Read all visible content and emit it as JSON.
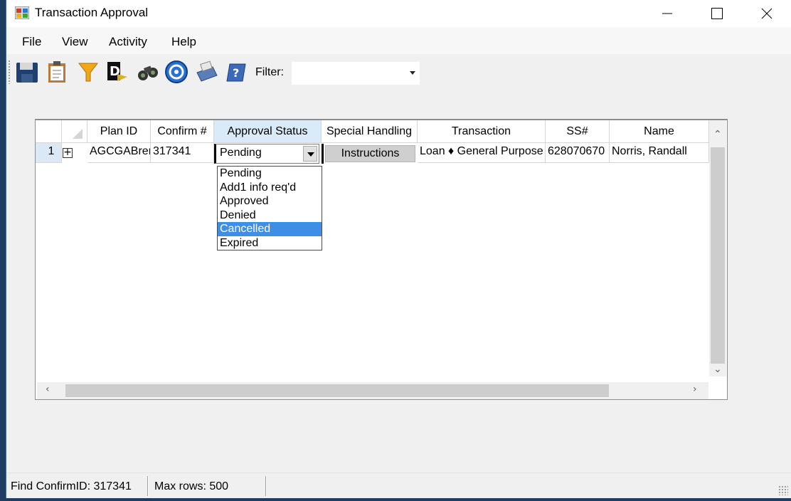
{
  "window": {
    "title": "Transaction Approval"
  },
  "menu": {
    "items": [
      {
        "label": "File"
      },
      {
        "label": "View"
      },
      {
        "label": "Activity"
      },
      {
        "label": "Help"
      }
    ]
  },
  "toolbar": {
    "icons": [
      "save-icon",
      "clipboard-icon",
      "filter-funnel-icon",
      "document-arrow-icon",
      "binoculars-icon",
      "refresh-globe-icon",
      "print-icon",
      "help-book-icon"
    ],
    "filter_label": "Filter:",
    "filter_value": ""
  },
  "grid": {
    "columns": [
      "Plan ID",
      "Confirm #",
      "Approval Status",
      "Special Handling",
      "Transaction",
      "SS#",
      "Name"
    ],
    "rows": [
      {
        "row_number": "1",
        "plan_id": "AGCGABrer",
        "confirm": "317341",
        "approval_status": "Pending",
        "special_handling": "Instructions",
        "transaction": "Loan ♦ General Purpose",
        "ssn": "628070670",
        "name": "Norris, Randall"
      }
    ],
    "status_options": [
      "Pending",
      "Add1 info req'd",
      "Approved",
      "Denied",
      "Cancelled",
      "Expired"
    ],
    "highlighted_option": "Cancelled"
  },
  "statusbar": {
    "find_confirm": "Find ConfirmID: 317341",
    "max_rows": "Max rows: 500"
  },
  "colors": {
    "selection": "#3f8ee6",
    "active_header": "#d9ebf9",
    "row_header": "#dbe9f6"
  }
}
